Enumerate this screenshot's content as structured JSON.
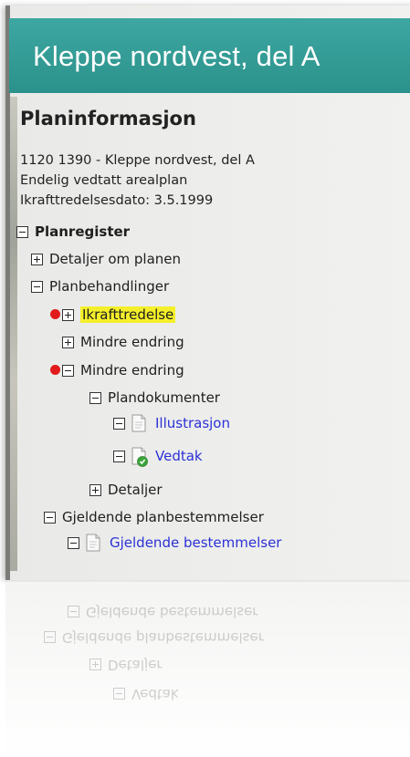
{
  "header": {
    "title": "Kleppe nordvest, del A"
  },
  "planinfo": {
    "heading": "Planinformasjon",
    "line1": "1120 1390 - Kleppe nordvest, del A",
    "line2": "Endelig vedtatt arealplan",
    "line3": "Ikrafttredelsesdato: 3.5.1999"
  },
  "tree": {
    "planregister": "Planregister",
    "detaljer_om_planen": "Detaljer om planen",
    "planbehandlinger": "Planbehandlinger",
    "ikrafttredelse": "Ikrafttredelse",
    "mindre_endring_1": "Mindre endring",
    "mindre_endring_2": "Mindre endring",
    "plandokumenter": "Plandokumenter",
    "illustrasjon": "Illustrasjon",
    "vedtak": "Vedtak",
    "detaljer": "Detaljer",
    "gjeldende_planbestemmelser": "Gjeldende planbestemmelser",
    "gjeldende_bestemmelser": "Gjeldende bestemmelser"
  },
  "colors": {
    "header": "#2f9a94",
    "link": "#2b31d6",
    "highlight": "#f4ef2a",
    "marker": "#e11b1b"
  },
  "icons": [
    "expand-icon",
    "collapse-icon",
    "document-icon",
    "document-approved-icon",
    "red-marker-dot"
  ]
}
